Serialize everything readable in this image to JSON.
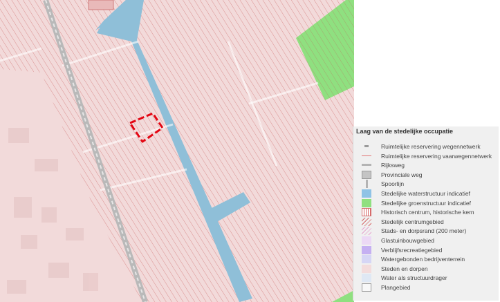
{
  "map": {
    "colors": {
      "urban_fill": "#f2dada",
      "hatch": "#cf6b6b",
      "water": "#8fbfd8",
      "green": "#8fe080",
      "railway": "#b9b9b9",
      "plan_area": "#e30613"
    }
  },
  "legend": {
    "title": "Laag van de stedelijke occupatie",
    "items": [
      {
        "label": "Ruimtelijke reservering wegennetwerk",
        "symbol": "dash-gray",
        "icon": "road-reservation-icon"
      },
      {
        "label": "Ruimtelijke reservering vaarwegennetwerk",
        "symbol": "line-red",
        "icon": "waterway-reservation-icon"
      },
      {
        "label": "Rijksweg",
        "symbol": "line-gray",
        "icon": "national-road-icon"
      },
      {
        "label": "Provinciale weg",
        "symbol": "box-gray",
        "icon": "provincial-road-icon"
      },
      {
        "label": "Spoorlijn",
        "symbol": "rail",
        "icon": "railway-icon"
      },
      {
        "label": "Stedelijke waterstructuur indicatief",
        "symbol": "fill-blue",
        "icon": "water-structure-icon"
      },
      {
        "label": "Stedelijke groenstructuur indicatief",
        "symbol": "fill-green",
        "icon": "green-structure-icon"
      },
      {
        "label": "Historisch centrum, historische kern",
        "symbol": "hist",
        "icon": "historic-centre-icon"
      },
      {
        "label": "Stedelijk centrumgebied",
        "symbol": "hatch-red",
        "icon": "urban-centre-icon"
      },
      {
        "label": "Stads- en dorpsrand (200 meter)",
        "symbol": "hatch-pink",
        "icon": "town-edge-icon"
      },
      {
        "label": "Glastuinbouwgebied",
        "symbol": "fill-lavender",
        "icon": "greenhouse-area-icon"
      },
      {
        "label": "Verblijfsrecreatiegebied",
        "symbol": "fill-purple",
        "icon": "recreation-area-icon"
      },
      {
        "label": "Watergebonden bedrijventerrein",
        "symbol": "fill-periwinkle",
        "icon": "water-business-icon"
      },
      {
        "label": "Steden en dorpen",
        "symbol": "fill-pink",
        "icon": "towns-villages-icon"
      },
      {
        "label": "Water als structuurdrager",
        "symbol": "fill-palewater",
        "icon": "water-carrier-icon"
      },
      {
        "label": "Plangebied",
        "symbol": "outline",
        "icon": "plan-area-icon"
      }
    ]
  }
}
